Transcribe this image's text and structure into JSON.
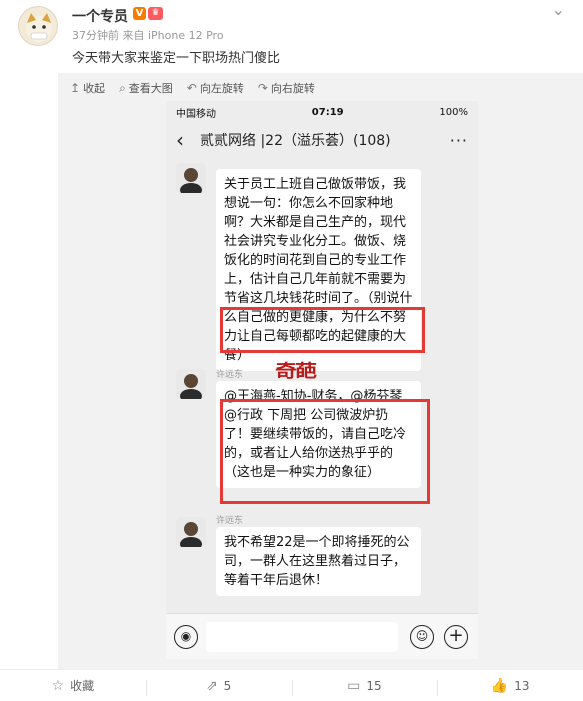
{
  "post": {
    "username": "一个专员",
    "badge_v": "V",
    "badge_tag": "♛",
    "meta": "37分钟前 来自 iPhone 12 Pro",
    "more": "⌄",
    "text": "今天带大家来鉴定一下职场热门傻比"
  },
  "toolbar": {
    "items": [
      {
        "icon": "↥",
        "label": "收起"
      },
      {
        "icon": "⌕",
        "label": "查看大图"
      },
      {
        "icon": "↶",
        "label": "向左旋转"
      },
      {
        "icon": "↷",
        "label": "向右旋转"
      }
    ]
  },
  "phone": {
    "status": {
      "carrier": "中国移动",
      "time": "07:19",
      "battery": "100%"
    },
    "chat_title": "贰贰网络 |22（溢乐荟）(108)",
    "back": "‹",
    "more": "···",
    "messages": [
      {
        "name": "",
        "text": "关于员工上班自己做饭带饭，我想说一句：你怎么不回家种地啊？大米都是自己生产的，现代社会讲究专业化分工。做饭、烧饭化的时间花到自己的专业工作上，估计自己几年前就不需要为节省这几块钱花时间了。（别说什么自己做的更健康，为什么不努力让自己每顿都吃的起健康的大餐）"
      },
      {
        "name": "许远东",
        "text": "@王海燕-知协-财务，@杨芬琴@行政 下周把 公司微波炉扔了！要继续带饭的，请自己吃冷的，或者让人给你送热乎乎的（这也是一种实力的象征）"
      },
      {
        "name": "许远东",
        "text": "我不希望22是一个即将捶死的公司，一群人在这里熬着过日子，等着干年后退休！"
      }
    ],
    "stamp": "奇葩"
  },
  "footer": {
    "collect": "收藏",
    "repost": "5",
    "comment": "15",
    "like": "13"
  }
}
